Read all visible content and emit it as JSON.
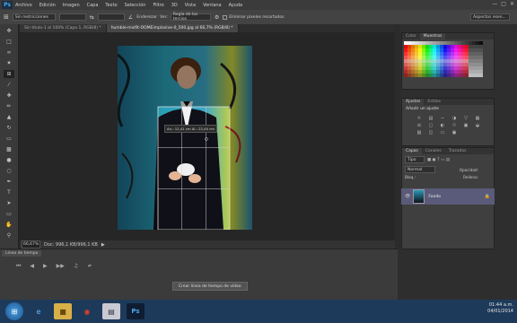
{
  "app": {
    "logo": "Ps"
  },
  "menu": [
    "Archivo",
    "Edición",
    "Imagen",
    "Capa",
    "Texto",
    "Selección",
    "Filtro",
    "3D",
    "Vista",
    "Ventana",
    "Ayuda"
  ],
  "options": {
    "style_value": "Sin restricciones",
    "blank_value": "",
    "enderezar_label": "Enderezar",
    "ver_label": "Ver:",
    "ver_value": "Regla de los tercios",
    "delete_cropped_label": "Eliminar píxeles recortados",
    "workspace_value": "Aspectos esen..."
  },
  "tabs": [
    {
      "label": "Sin título-1 al 100% (Capa 1, RGB/8) *"
    },
    {
      "label": "humble-misfit-OOMEimplosive-0_500.jpg al 66,7% (RGB/8) *"
    }
  ],
  "canvas": {
    "crop_readout": "An.: 12,41 cm  Al.: 22,40 cm"
  },
  "status": {
    "zoom": "66,67%",
    "doc": "Doc: 996,1 KB/996,1 KB"
  },
  "timeline": {
    "tab_label": "Línea de tiempo",
    "create_button": "Crear línea de tiempo de vídeo"
  },
  "panels": {
    "color_tabs": [
      "Color",
      "Muestras"
    ],
    "adjust_tabs": [
      "Ajustes",
      "Estilos"
    ],
    "adjust_title": "Añadir un ajuste",
    "layers_tabs": [
      "Capas",
      "Canales",
      "Trazados"
    ],
    "layers_kind": "Tipo",
    "blend_mode": "Normal",
    "opacity_label": "Opacidad:",
    "fill_label": "Relleno:",
    "lock_label": "Bloq.:",
    "layer_name": "Fondo"
  },
  "colors": {
    "foreground": "#ff00ff",
    "background": "#ffffff"
  },
  "taskbar": {
    "items": [
      "windows-start",
      "internet-explorer",
      "file-explorer",
      "chrome",
      "windows-explorer",
      "photoshop"
    ],
    "time": "01:44 a.m.",
    "date": "04/01/2014"
  }
}
